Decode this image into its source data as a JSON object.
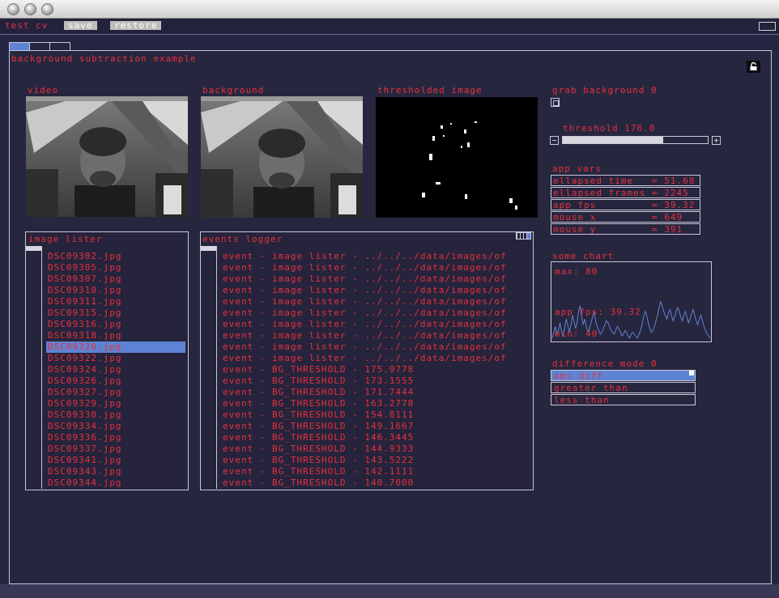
{
  "app": {
    "title": "test cv",
    "save_label": "save",
    "restore_label": "restore"
  },
  "panel": {
    "title": "background subtraction example"
  },
  "video": {
    "label": "video"
  },
  "background": {
    "label": "background"
  },
  "thresholded": {
    "label": "thresholded image"
  },
  "grab": {
    "label": "grab background 0"
  },
  "threshold": {
    "label": "threshold 176.0",
    "value": 176.0,
    "fraction": 0.69
  },
  "app_vars": {
    "title": "app vars",
    "rows": [
      "ellapsed time   = 51.68",
      "ellapsed frames = 2245",
      "app fps         = 39.32",
      "mouse x         = 649",
      "mouse y         = 391"
    ]
  },
  "chart": {
    "title": "some chart",
    "max_label": "max: 80",
    "series_label": "app fps: 39.32",
    "min_label": "min: 40"
  },
  "chart_data": {
    "type": "line",
    "title": "some chart",
    "ylim": [
      40,
      80
    ],
    "series": [
      {
        "name": "app fps",
        "values": [
          41,
          44,
          47,
          43,
          45,
          49,
          44,
          42,
          46,
          51,
          48,
          44,
          47,
          53,
          50,
          46,
          49,
          55,
          58,
          52,
          48,
          51,
          47,
          44,
          46,
          49,
          52,
          55,
          50,
          47,
          45,
          43,
          44,
          46,
          48,
          50,
          49,
          47,
          45,
          44,
          43,
          45,
          47,
          46,
          44,
          42,
          43,
          45,
          44,
          42,
          41,
          43,
          44,
          43,
          42,
          41,
          43,
          45,
          48,
          52,
          55,
          53,
          49,
          46,
          44,
          45,
          47,
          50,
          53,
          57,
          60,
          58,
          55,
          53,
          51,
          54,
          56,
          53,
          50,
          52,
          55,
          57,
          55,
          52,
          50,
          53,
          55,
          52,
          49,
          51,
          54,
          56,
          53,
          50,
          48,
          51,
          53,
          50,
          47,
          45,
          43,
          42,
          41
        ]
      }
    ]
  },
  "difference": {
    "label": "difference mode 0",
    "options": [
      "abs diff",
      "greater than",
      "less than"
    ],
    "selected_index": 0
  },
  "image_lister": {
    "title": "image lister",
    "items": [
      "DSC09302.jpg",
      "DSC09305.jpg",
      "DSC09307.jpg",
      "DSC09310.jpg",
      "DSC09311.jpg",
      "DSC09315.jpg",
      "DSC09316.jpg",
      "DSC09318.jpg",
      "DSC09320.jpg",
      "DSC09322.jpg",
      "DSC09324.jpg",
      "DSC09326.jpg",
      "DSC09327.jpg",
      "DSC09329.jpg",
      "DSC09330.jpg",
      "DSC09334.jpg",
      "DSC09336.jpg",
      "DSC09337.jpg",
      "DSC09341.jpg",
      "DSC09343.jpg",
      "DSC09344.jpg"
    ],
    "selected_index": 8
  },
  "events_logger": {
    "title": "events logger",
    "items": [
      "event - image lister - ../../../data/images/of",
      "event - image lister - ../../../data/images/of",
      "event - image lister - ../../../data/images/of",
      "event - image lister - ../../../data/images/of",
      "event - image lister - ../../../data/images/of",
      "event - image lister - ../../../data/images/of",
      "event - image lister - ../../../data/images/of",
      "event - image lister - ../../../data/images/of",
      "event - image lister - ../../../data/images/of",
      "event - image lister - ../../../data/images/of",
      "event - BG_THRESHOLD - 175.9778",
      "event - BG_THRESHOLD - 173.1555",
      "event - BG_THRESHOLD - 171.7444",
      "event - BG_THRESHOLD - 163.2778",
      "event - BG_THRESHOLD - 154.8111",
      "event - BG_THRESHOLD - 149.1667",
      "event - BG_THRESHOLD - 146.3445",
      "event - BG_THRESHOLD - 144.9333",
      "event - BG_THRESHOLD - 143.5222",
      "event - BG_THRESHOLD - 142.1111",
      "event - BG_THRESHOLD - 140.7000"
    ]
  },
  "colors": {
    "background": "#262542",
    "text": "#e8303c",
    "highlight": "#5d84d4",
    "border": "#c8c8d8",
    "chart_line": "#5d84d4"
  }
}
